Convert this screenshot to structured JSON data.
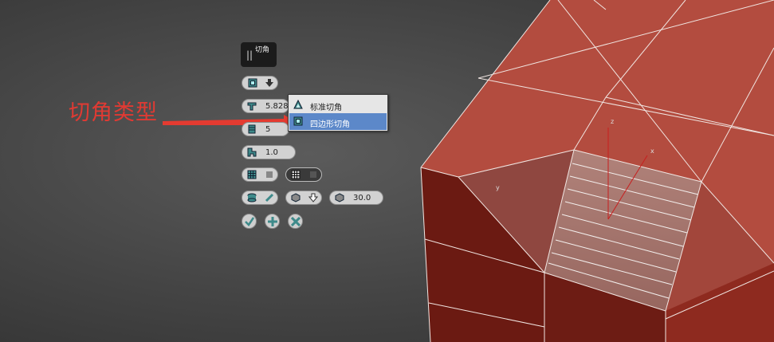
{
  "annotation": {
    "text": "切角类型"
  },
  "caddy": {
    "title": "切角",
    "amount": "5.828",
    "segments": "5",
    "tension": "1.0",
    "angle": "30.0"
  },
  "dropdown": {
    "options": [
      {
        "label": "标准切角",
        "icon": "triangle-icon",
        "selected": false
      },
      {
        "label": "四边形切角",
        "icon": "quad-icon",
        "selected": true
      }
    ]
  },
  "colors": {
    "mesh": "#b04b3e",
    "dark_face": "#6a1a12",
    "accent": "#5c88c9",
    "annotation": "#e03a33"
  }
}
